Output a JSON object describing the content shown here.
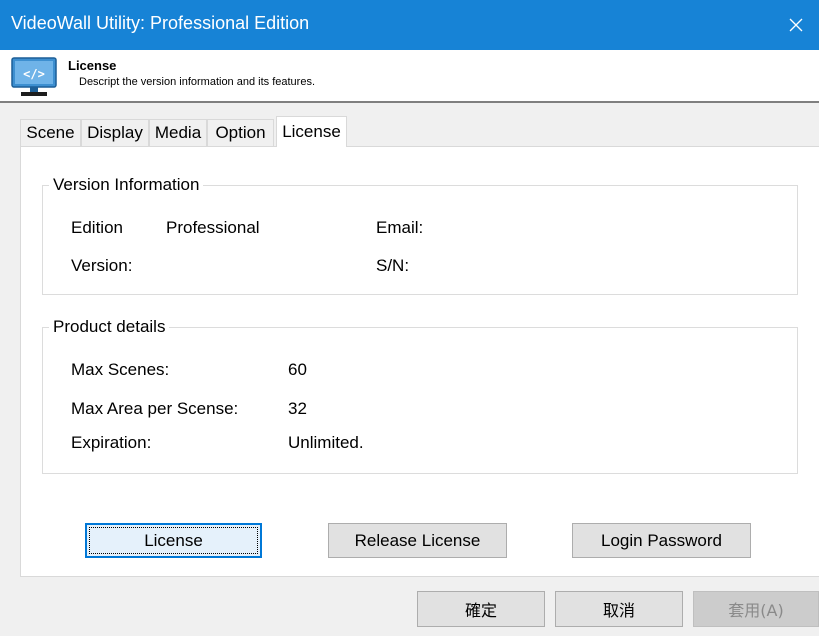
{
  "window": {
    "title": "VideoWall Utility: Professional Edition"
  },
  "header": {
    "icon": "monitor-code-icon",
    "title": "License",
    "description": "Descript the version information and its features."
  },
  "tabs": [
    "Scene",
    "Display",
    "Media",
    "Option",
    "License"
  ],
  "active_tab": "License",
  "version_info": {
    "legend": "Version Information",
    "edition_label": "Edition",
    "edition_value": "Professional",
    "email_label": "Email:",
    "version_label": "Version:",
    "sn_label": "S/N:"
  },
  "product_details": {
    "legend": "Product details",
    "max_scenes_label": "Max Scenes:",
    "max_scenes_value": "60",
    "max_area_label": "Max Area per Scense:",
    "max_area_value": "32",
    "expiration_label": "Expiration:",
    "expiration_value": "Unlimited."
  },
  "actions": {
    "license": "License",
    "release_license": "Release License",
    "login_password": "Login Password"
  },
  "dialog_buttons": {
    "ok": "確定",
    "cancel": "取消",
    "apply": "套用(A)"
  },
  "colors": {
    "titlebar": "#1783d6",
    "accent": "#0078d7"
  }
}
